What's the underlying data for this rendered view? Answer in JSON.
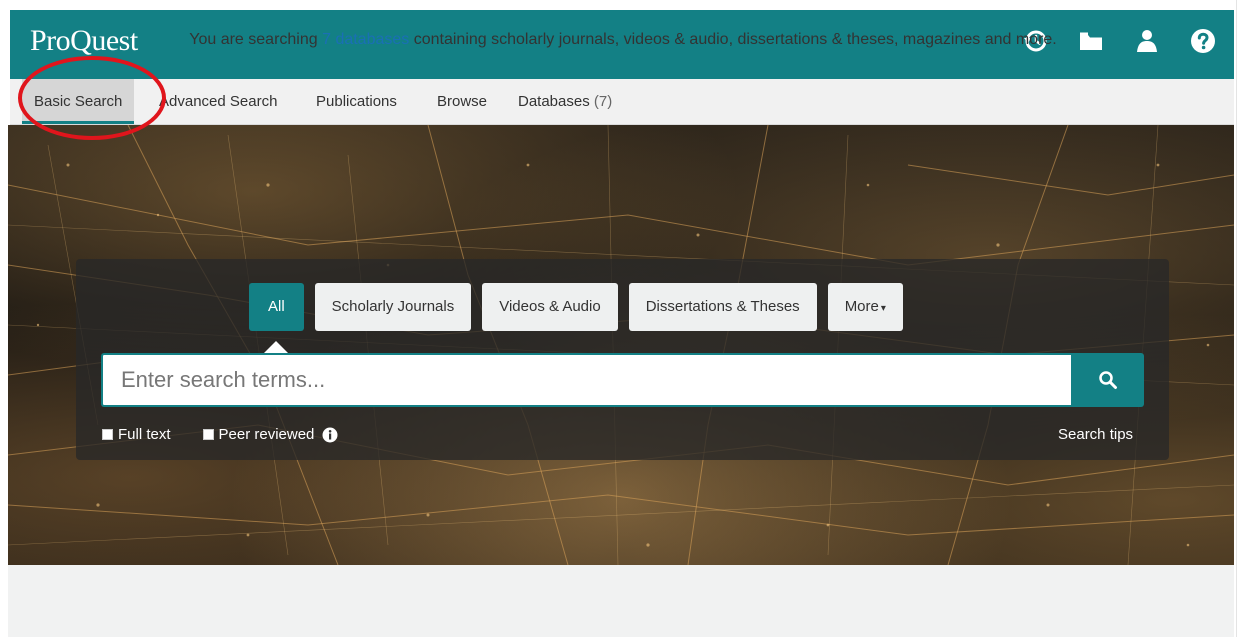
{
  "header": {
    "logo": "ProQuest",
    "icons": [
      "history-icon",
      "folder-icon",
      "user-icon",
      "help-icon"
    ]
  },
  "nav": {
    "items": [
      {
        "label": "Basic Search",
        "active": true
      },
      {
        "label": "Advanced Search"
      },
      {
        "label": "Publications"
      },
      {
        "label": "Browse"
      },
      {
        "label": "Databases",
        "count": "(7)"
      }
    ]
  },
  "search": {
    "tabs": [
      {
        "label": "All",
        "active": true
      },
      {
        "label": "Scholarly Journals"
      },
      {
        "label": "Videos & Audio"
      },
      {
        "label": "Dissertations & Theses"
      },
      {
        "label": "More"
      }
    ],
    "placeholder": "Enter search terms...",
    "options": {
      "full_text": "Full text",
      "peer_reviewed": "Peer reviewed"
    },
    "tips": "Search tips"
  },
  "footer": {
    "prefix": "You are searching ",
    "link": "7 databases",
    "suffix": " containing scholarly journals, videos & audio, dissertations & theses, magazines and more."
  },
  "colors": {
    "brand": "#138085",
    "link": "#1a6fb5",
    "annotation": "#e0151c"
  }
}
